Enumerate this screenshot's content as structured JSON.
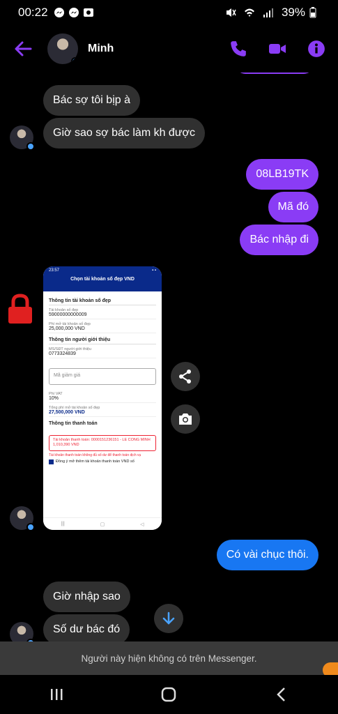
{
  "status_bar": {
    "time": "00:22",
    "battery": "39%"
  },
  "header": {
    "contact_name": "Minh",
    "colors": {
      "accent": "#8a3cf5"
    }
  },
  "messages": [
    {
      "from": "them",
      "text": "Bác sợ tôi bịp à"
    },
    {
      "from": "them",
      "text": "Giờ sao sợ bác làm kh được"
    },
    {
      "from": "me",
      "text": "08LB19TK"
    },
    {
      "from": "me",
      "text": "Mã đó"
    },
    {
      "from": "me",
      "text": "Bác nhập đi"
    },
    {
      "from": "me",
      "text": "Có vài chục thôi."
    },
    {
      "from": "them",
      "text": "Giờ nhập sao"
    },
    {
      "from": "them",
      "text": "Số dư bác đó"
    }
  ],
  "shared_screenshot": {
    "time": "23:57",
    "title": "Chọn tài khoản số đẹp VND",
    "section1": "Thông tin tài khoản số đẹp",
    "acc_label": "Tài khoản số đẹp",
    "acc_value": "59000000000009",
    "fee_label": "Phí mở tài khoản số đẹp",
    "fee_value": "25,000,000 VND",
    "section2": "Thông tin người giới thiệu",
    "ref_label": "MS/SĐT người giới thiệu",
    "ref_value": "0773324839",
    "discount_placeholder": "Mã giảm giá",
    "vat_label": "Phí VAT",
    "vat_value": "10%",
    "total_label": "Tổng phí mở tài khoản số đẹp",
    "total_value": "27,500,000 VND",
    "section3": "Thông tin thanh toán",
    "pay_account": "Tài khoản thanh toán: 0000151236151 - LE CONG MINH",
    "pay_balance": "1,010,390 VND",
    "error": "Tài khoản thanh toán không đủ số dư để thanh toán dịch vụ",
    "agree": "Đồng ý mở thêm tài khoản thanh toán VND số"
  },
  "notice": "Người này hiện không có trên Messenger."
}
